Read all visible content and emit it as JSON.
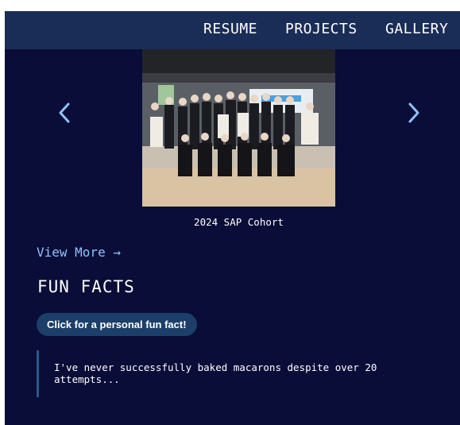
{
  "nav": {
    "items": [
      "RESUME",
      "PROJECTS",
      "GALLERY"
    ]
  },
  "carousel": {
    "prev_icon": "chevron-left-icon",
    "next_icon": "chevron-right-icon",
    "image_caption": "2024 SAP Cohort"
  },
  "view_more": {
    "label": "View More →"
  },
  "fun_facts": {
    "title": "FUN FACTS",
    "button_label": "Click for a personal fun fact!",
    "fact_text": "I've never successfully baked macarons despite over 20 attempts..."
  },
  "colors": {
    "background": "#0a0d37",
    "navbar": "#1a2d57",
    "accent": "#8ec3ff",
    "button": "#1c3f69",
    "quote_border": "#2b5a8c"
  }
}
